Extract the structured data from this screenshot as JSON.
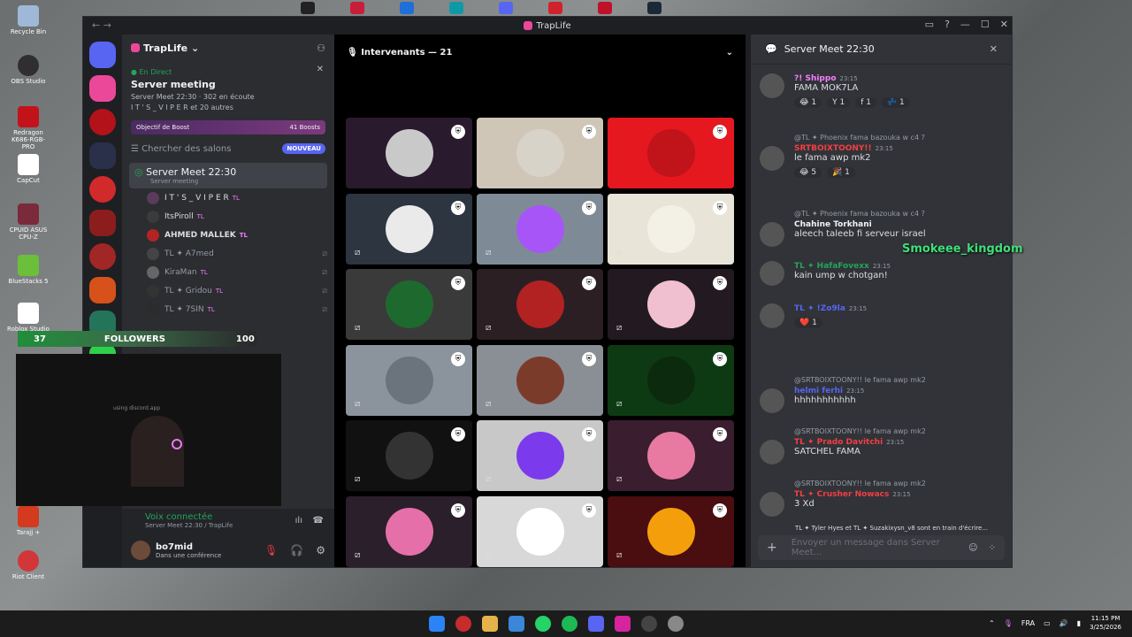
{
  "desktop": {
    "icons": [
      "Recycle Bin",
      "OBS Studio",
      "Redragon K686-RGB-PRO",
      "CapCut",
      "CPUID ASUS CPU-Z",
      "BlueStacks 5",
      "Roblox Studio",
      "Tarajj +",
      "Riot Client"
    ]
  },
  "window": {
    "title": "TrapLife"
  },
  "server": {
    "name": "TrapLife",
    "live_tag": "En Direct",
    "live_title": "Server meeting",
    "live_meta": "Server Meet 22:30 · 302 en écoute",
    "live_people": "I T ' S _ V I P E R et 20 autres",
    "boost_label": "Objectif de Boost",
    "boost_count": "41 Boosts",
    "search_channels": "Chercher des salons",
    "new_badge": "NOUVEAU"
  },
  "voice_channel": {
    "name": "Server Meet 22:30",
    "sub": "Server meeting",
    "members": [
      {
        "name": "I T ' S _ V I P E R",
        "badge": "TL"
      },
      {
        "name": "ItsPiroll",
        "badge": "TL"
      },
      {
        "name": "AHMED MALLEK",
        "badge": "TL"
      },
      {
        "name": "TL ✦ A7med",
        "badge": ""
      },
      {
        "name": "KiraMan",
        "badge": "TL"
      },
      {
        "name": "TL ✦ Gridou",
        "badge": "TL"
      },
      {
        "name": "TL ✦ 7SIN",
        "badge": "TL"
      }
    ]
  },
  "overlay": {
    "followers_count": "37",
    "followers_label": "FOLLOWERS",
    "followers_goal": "100",
    "cam_text": "using discord.app"
  },
  "voice_status": {
    "label": "Voix connectée",
    "sub": "Server Meet 22:30 / TrapLife"
  },
  "user": {
    "name": "bo7mid",
    "status": "Dans une conférence"
  },
  "stage": {
    "header": "Intervenants — 21"
  },
  "chat": {
    "title": "Server Meet 22:30",
    "overlay_name": "Smokeee_kingdom",
    "messages": [
      {
        "author": "?! Shippo",
        "time": "23:15",
        "reply": "",
        "text": "FAMA MOK7LA",
        "color": "#f47fff",
        "reacts": [
          "😂 1",
          "Y 1",
          "f 1",
          "💤 1"
        ]
      },
      {
        "author": "SRTBOIXTOONY!!",
        "time": "23:15",
        "reply": "@TL ✦ Phoenix  fama bazouka w c4 ?",
        "text": "le fama awp mk2",
        "color": "#f23f43",
        "reacts": [
          "😂 5",
          "🎉 1"
        ]
      },
      {
        "author": "Chahine Torkhani",
        "time": "",
        "reply": "@TL ✦ Phoenix  fama bazouka w c4 ?",
        "text": "aleech taleeb fi serveur israel",
        "color": "#f2f3f5",
        "reacts": []
      },
      {
        "author": "TL ✦ HafaFovexx",
        "time": "23:15",
        "reply": "",
        "text": "kain ump w chotgan!",
        "color": "#23a55a",
        "reacts": []
      },
      {
        "author": "TL ✦ !Zo9la",
        "time": "23:15",
        "reply": "",
        "text": "",
        "color": "#5865f2",
        "reacts": [
          "❤️ 1"
        ]
      },
      {
        "author": "helmi ferhi",
        "time": "23:15",
        "reply": "@SRTBOIXTOONY!!  le fama awp mk2",
        "text": "hhhhhhhhhhh",
        "color": "#5865f2",
        "reacts": []
      },
      {
        "author": "TL ✦ Prado Davitchi",
        "time": "23:15",
        "reply": "@SRTBOIXTOONY!!  le fama awp mk2",
        "text": "SATCHEL FAMA",
        "color": "#f23f43",
        "reacts": []
      },
      {
        "author": "TL ✦ Crusher Nowacs",
        "time": "23:15",
        "reply": "@SRTBOIXTOONY!!  le fama awp mk2",
        "text": "3 Xd",
        "color": "#f23f43",
        "reacts": []
      }
    ],
    "typing": "TL ✦ Tyler Hyes et TL ✦ Suzakixysn_v8 sont en train d'écrire...",
    "composer_placeholder": "Envoyer un message dans Server Meet..."
  },
  "taskbar": {
    "lang": "FRA",
    "time": "11:15 PM",
    "date": "3/25/2026"
  }
}
